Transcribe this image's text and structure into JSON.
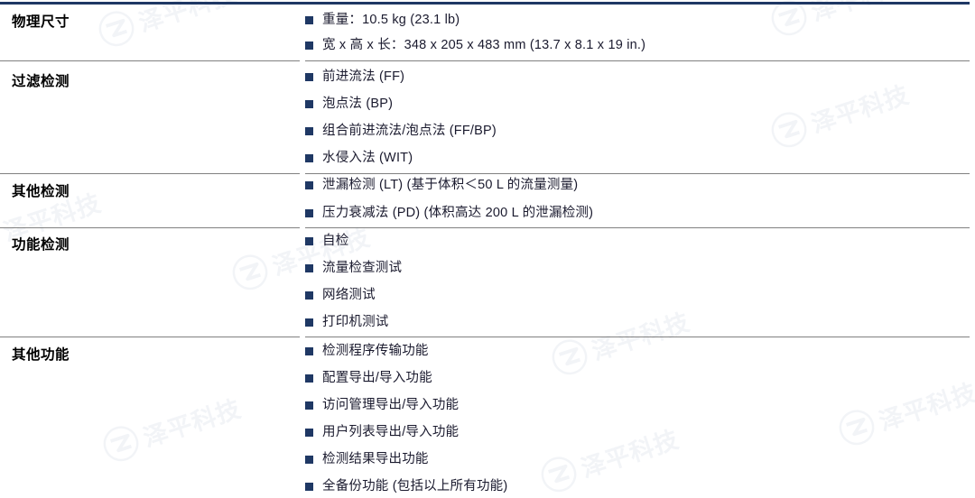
{
  "document": {
    "type": "specification-table",
    "accent_color": "#1f3864",
    "rule_color": "#808080",
    "text_color": "#1a1a2e",
    "heading_color": "#000000",
    "background": "#ffffff"
  },
  "watermark": {
    "text": "泽平科技",
    "logo": "z-circle-logo",
    "color": "#e6eaf1"
  },
  "sections": [
    {
      "category": "物理尺寸",
      "items": [
        "重量：10.5 kg (23.1 lb)",
        "宽 x 高 x 长：348 x 205 x 483 mm (13.7 x 8.1 x 19 in.)"
      ]
    },
    {
      "category": "过滤检测",
      "items": [
        "前进流法 (FF)",
        "泡点法 (BP)",
        "组合前进流法/泡点法 (FF/BP)",
        "水侵入法 (WIT)"
      ]
    },
    {
      "category": "其他检测",
      "items": [
        "泄漏检测 (LT) (基于体积＜50 L 的流量测量)",
        "压力衰减法 (PD) (体积高达 200 L 的泄漏检测)"
      ]
    },
    {
      "category": "功能检测",
      "items": [
        "自检",
        "流量检查测试",
        "网络测试",
        "打印机测试"
      ]
    },
    {
      "category": "其他功能",
      "items": [
        "检测程序传输功能",
        "配置导出/导入功能",
        "访问管理导出/导入功能",
        "用户列表导出/导入功能",
        "检测结果导出功能",
        "全备份功能 (包括以上所有功能)"
      ]
    }
  ]
}
